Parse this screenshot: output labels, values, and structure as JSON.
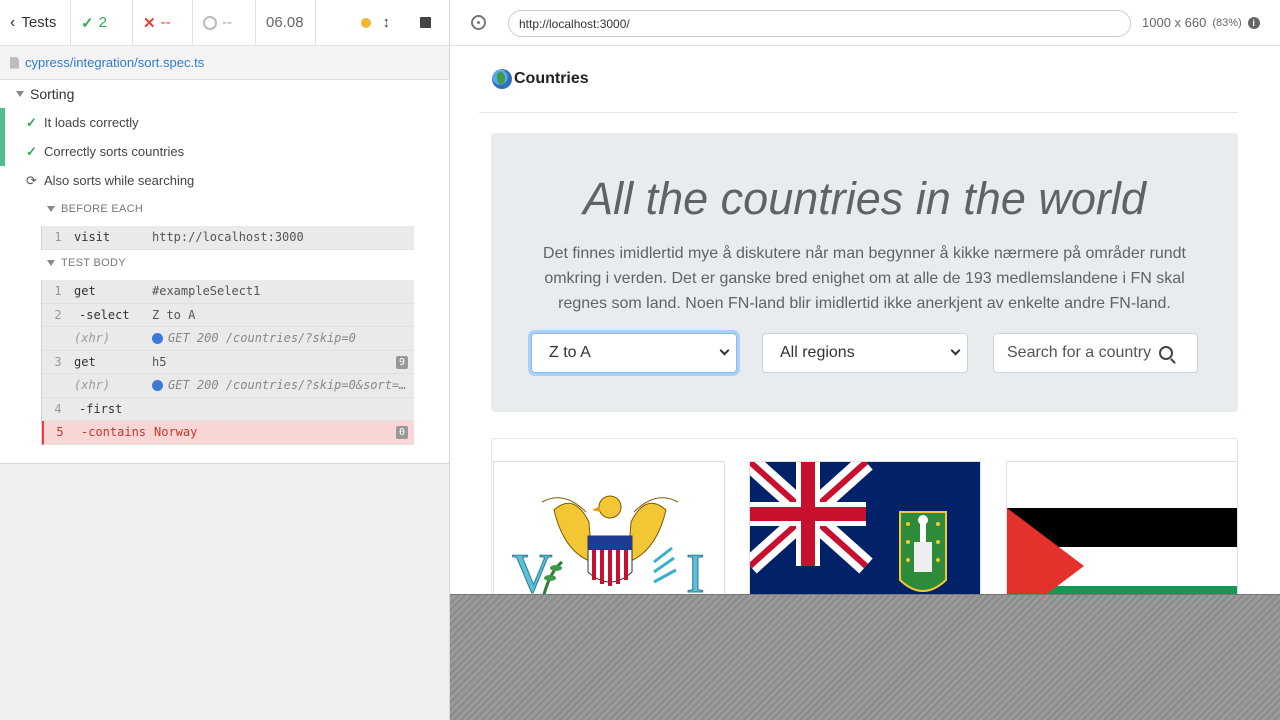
{
  "reporter": {
    "tests_label": "Tests",
    "passed_count": "2",
    "failed_count": "--",
    "pending_count": "--",
    "duration": "06.08",
    "spec_path": "cypress/integration/sort.spec.ts",
    "suite_title": "Sorting",
    "tests": [
      {
        "title": "It loads correctly",
        "state": "passed"
      },
      {
        "title": "Correctly sorts countries",
        "state": "passed"
      },
      {
        "title": "Also sorts while searching",
        "state": "running"
      }
    ],
    "before_each_label": "BEFORE EACH",
    "test_body_label": "TEST BODY",
    "before_each_commands": [
      {
        "num": "1",
        "name": "visit",
        "message": "http://localhost:3000"
      }
    ],
    "test_body_commands": [
      {
        "num": "1",
        "name": "get",
        "message": "#exampleSelect1"
      },
      {
        "num": "2",
        "name": "-select",
        "message": "Z to A"
      },
      {
        "num": "",
        "name": "(xhr)",
        "message": "GET 200 /countries/?skip=0"
      },
      {
        "num": "3",
        "name": "get",
        "message": "h5",
        "badge": "9"
      },
      {
        "num": "",
        "name": "(xhr)",
        "message": "GET 200 /countries/?skip=0&sort=…"
      },
      {
        "num": "4",
        "name": "-first",
        "message": ""
      },
      {
        "num": "5",
        "name": "-contains",
        "message": "Norway",
        "badge": "0"
      }
    ]
  },
  "aut": {
    "url": "http://localhost:3000/",
    "viewport_size": "1000 x 660",
    "viewport_scale": "(83%)",
    "app": {
      "brand": "Countries",
      "heading": "All the countries in the world",
      "lead": "Det finnes imidlertid mye å diskutere når man begynner å kikke nærmere på områder rundt omkring i verden. Det er ganske bred enighet om at alle de 193 medlemslandene i FN skal regnes som land. Noen FN-land blir imidlertid ikke anerkjent av enkelte andre FN-land.",
      "sort_select": "Z to A",
      "region_select": "All regions",
      "search_placeholder": "Search for a country"
    }
  },
  "colors": {
    "passed": "#3aa657",
    "failed": "#e2413e",
    "link": "#2f7bd1",
    "jumbotron": "#e9ecef"
  }
}
